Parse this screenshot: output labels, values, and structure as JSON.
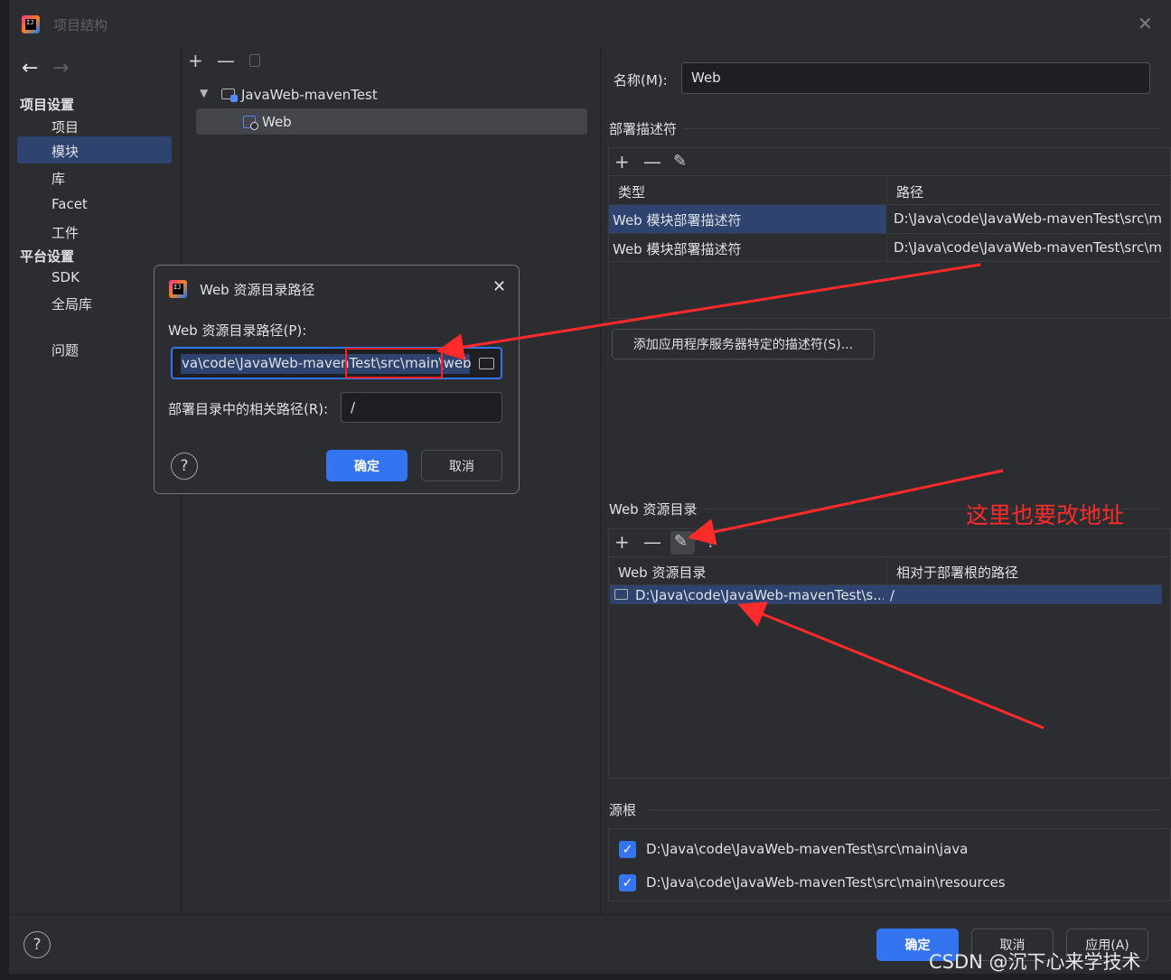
{
  "window": {
    "title": "项目结构"
  },
  "sidebar": {
    "section_project": "项目设置",
    "items_project": [
      "项目",
      "模块",
      "库",
      "Facet",
      "工件"
    ],
    "section_platform": "平台设置",
    "items_platform": [
      "SDK",
      "全局库"
    ],
    "problems": "问题"
  },
  "tree": {
    "root": "JavaWeb-mavenTest",
    "child": "Web"
  },
  "right": {
    "name_label": "名称(M):",
    "name_value": "Web",
    "deploy_section": "部署描述符",
    "deploy_table": {
      "headers": [
        "类型",
        "路径"
      ],
      "rows": [
        [
          "Web 模块部署描述符",
          "D:\\Java\\code\\JavaWeb-mavenTest\\src\\m"
        ],
        [
          "Web 模块部署描述符",
          "D:\\Java\\code\\JavaWeb-mavenTest\\src\\m"
        ]
      ]
    },
    "add_descriptor_button": "添加应用程序服务器特定的描述符(S)...",
    "web_res_section": "Web 资源目录",
    "web_res_table": {
      "headers": [
        "Web 资源目录",
        "相对于部署根的路径"
      ],
      "rows": [
        [
          "D:\\Java\\code\\JavaWeb-mavenTest\\s...",
          "/"
        ]
      ]
    },
    "source_roots_section": "源根",
    "source_roots": [
      "D:\\Java\\code\\JavaWeb-mavenTest\\src\\main\\java",
      "D:\\Java\\code\\JavaWeb-mavenTest\\src\\main\\resources"
    ]
  },
  "footer": {
    "ok": "确定",
    "cancel": "取消",
    "apply": "应用(A)",
    "help": "?"
  },
  "dialog": {
    "title": "Web 资源目录路径",
    "path_label": "Web 资源目录路径(P):",
    "path_value": "va\\code\\JavaWeb-mavenTest\\src\\main\\web",
    "rel_label": "部署目录中的相关路径(R):",
    "rel_value": "/",
    "ok": "确定",
    "cancel": "取消",
    "help": "?"
  },
  "annotation": {
    "text": "这里也要改地址"
  },
  "watermark": "CSDN @沉下心来学技术",
  "colors": {
    "accent": "#3574f0",
    "selection": "#2e436e",
    "annotation": "#ff2a2a"
  }
}
